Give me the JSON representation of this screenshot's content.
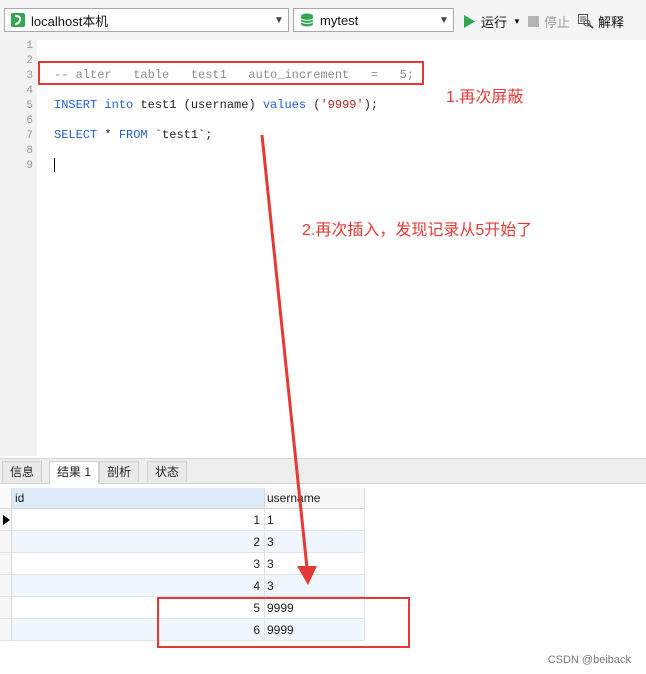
{
  "toolbar": {
    "connection": "localhost本机",
    "database": "mytest",
    "run_label": "运行",
    "stop_label": "停止",
    "explain_label": "解释"
  },
  "editor": {
    "line_numbers": [
      "1",
      "2",
      "3",
      "4",
      "5",
      "6",
      "7",
      "8",
      "9"
    ],
    "line3_comment": "-- alter   table   test1   auto_increment   =   5;",
    "line5": {
      "kw1": "INSERT",
      "kw2": "into",
      "plain1": " test1 (username) ",
      "kw3": "values",
      "plain2": " (",
      "str": "'9999'",
      "plain3": ");"
    },
    "line7": {
      "kw1": "SELECT",
      "plain1": " * ",
      "kw2": "FROM",
      "plain2": " `test1`;"
    }
  },
  "result_tabs": [
    "信息",
    "结果 1",
    "剖析",
    "状态"
  ],
  "result_table": {
    "columns": [
      "id",
      "username"
    ],
    "rows": [
      {
        "id": "1",
        "username": "1"
      },
      {
        "id": "2",
        "username": "3"
      },
      {
        "id": "3",
        "username": "3"
      },
      {
        "id": "4",
        "username": "3"
      },
      {
        "id": "5",
        "username": "9999"
      },
      {
        "id": "6",
        "username": "9999"
      }
    ]
  },
  "annotations": {
    "note1": "1.再次屏蔽",
    "note2": "2.再次插入，发现记录从5开始了"
  },
  "watermark": "CSDN @beiback",
  "colors": {
    "annotation_red": "#e53935",
    "keyword_blue": "#1f5fd6",
    "string_red": "#b3261e",
    "run_green": "#2fa84f"
  }
}
